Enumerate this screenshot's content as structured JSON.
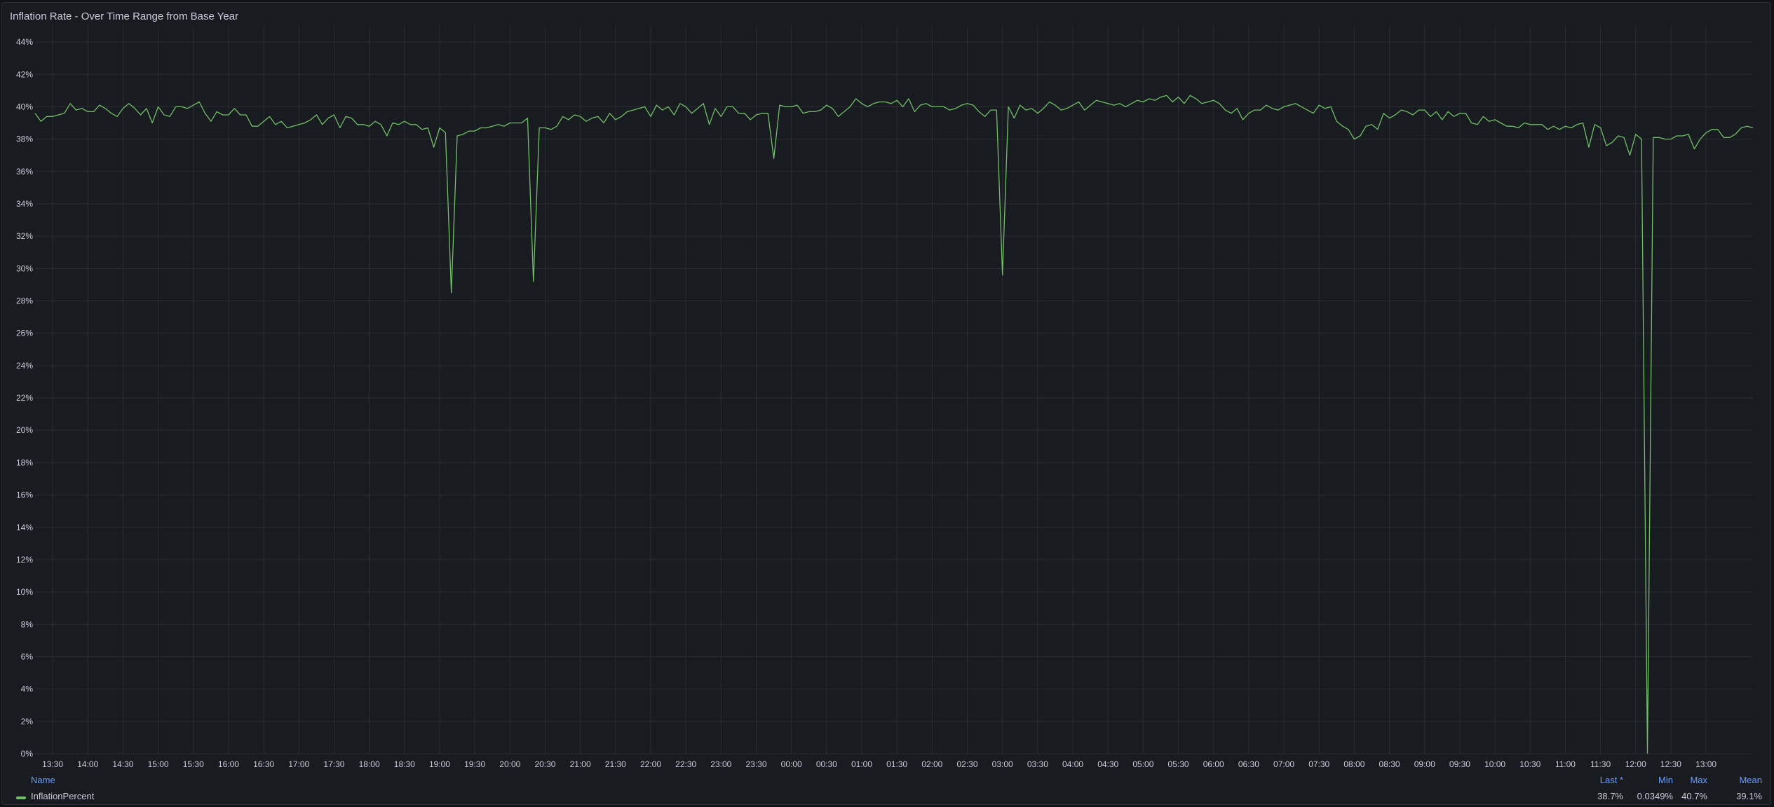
{
  "panel": {
    "title": "Inflation Rate - Over Time Range from Base Year"
  },
  "legend": {
    "headers": {
      "name": "Name",
      "last": "Last *",
      "min": "Min",
      "max": "Max",
      "mean": "Mean"
    },
    "series": [
      {
        "name": "InflationPercent",
        "color": "#73bf69",
        "last": "38.7%",
        "min": "0.0349%",
        "max": "40.7%",
        "mean": "39.1%"
      }
    ]
  },
  "chart_data": {
    "type": "line",
    "title": "Inflation Rate - Over Time Range from Base Year",
    "xlabel": "",
    "ylabel": "",
    "x_start": "13:15",
    "x_end": "13:00 (next day)",
    "x_step_minutes": 5,
    "x_ticks": [
      "13:30",
      "14:00",
      "14:30",
      "15:00",
      "15:30",
      "16:00",
      "16:30",
      "17:00",
      "17:30",
      "18:00",
      "18:30",
      "19:00",
      "19:30",
      "20:00",
      "20:30",
      "21:00",
      "21:30",
      "22:00",
      "22:30",
      "23:00",
      "23:30",
      "00:00",
      "00:30",
      "01:00",
      "01:30",
      "02:00",
      "02:30",
      "03:00",
      "03:30",
      "04:00",
      "04:30",
      "05:00",
      "05:30",
      "06:00",
      "06:30",
      "07:00",
      "07:30",
      "08:00",
      "08:30",
      "09:00",
      "09:30",
      "10:00",
      "10:30",
      "11:00",
      "11:30",
      "12:00",
      "12:30",
      "13:00"
    ],
    "y_ticks": [
      "0%",
      "2%",
      "4%",
      "6%",
      "8%",
      "10%",
      "12%",
      "14%",
      "16%",
      "18%",
      "20%",
      "22%",
      "24%",
      "26%",
      "28%",
      "30%",
      "32%",
      "34%",
      "36%",
      "38%",
      "40%",
      "42%",
      "44%"
    ],
    "ylim": [
      0,
      45
    ],
    "grid": true,
    "legend_placement": "bottom",
    "series": [
      {
        "name": "InflationPercent",
        "color": "#73bf69",
        "values": [
          39.6,
          39.1,
          39.4,
          39.4,
          39.5,
          39.6,
          40.2,
          39.8,
          39.9,
          39.7,
          39.7,
          40.1,
          39.9,
          39.6,
          39.4,
          39.9,
          40.2,
          39.9,
          39.5,
          39.9,
          39.0,
          40.0,
          39.5,
          39.4,
          40.0,
          40.0,
          39.9,
          40.1,
          40.3,
          39.6,
          39.1,
          39.7,
          39.5,
          39.5,
          39.9,
          39.5,
          39.5,
          38.8,
          38.8,
          39.1,
          39.4,
          38.9,
          39.1,
          38.7,
          38.8,
          38.9,
          39.0,
          39.2,
          39.5,
          38.9,
          39.3,
          39.5,
          38.7,
          39.4,
          39.3,
          38.9,
          38.9,
          38.8,
          39.1,
          38.9,
          38.2,
          39.0,
          38.9,
          39.1,
          38.9,
          38.9,
          38.6,
          38.7,
          37.5,
          38.7,
          38.4,
          28.5,
          38.2,
          38.3,
          38.5,
          38.5,
          38.7,
          38.7,
          38.8,
          38.9,
          38.8,
          39.0,
          39.0,
          39.0,
          39.3,
          29.2,
          38.7,
          38.7,
          38.6,
          38.8,
          39.4,
          39.2,
          39.5,
          39.4,
          39.1,
          39.3,
          39.4,
          39.0,
          39.6,
          39.2,
          39.4,
          39.7,
          39.8,
          39.9,
          40.0,
          39.4,
          40.1,
          39.8,
          40.0,
          39.5,
          40.2,
          40.0,
          39.6,
          39.9,
          40.2,
          38.9,
          39.9,
          39.4,
          40.0,
          40.0,
          39.6,
          39.6,
          39.2,
          39.5,
          39.6,
          39.6,
          36.8,
          40.1,
          40.0,
          40.0,
          40.1,
          39.6,
          39.7,
          39.7,
          39.8,
          40.1,
          39.9,
          39.4,
          39.7,
          40.0,
          40.5,
          40.2,
          40.0,
          40.2,
          40.3,
          40.3,
          40.2,
          40.4,
          40.0,
          40.5,
          39.7,
          40.1,
          40.2,
          40.0,
          40.0,
          40.0,
          39.8,
          39.9,
          40.1,
          40.2,
          40.1,
          39.7,
          39.4,
          39.8,
          39.8,
          29.6,
          40.0,
          39.3,
          40.1,
          39.8,
          39.9,
          39.6,
          39.9,
          40.3,
          40.1,
          39.8,
          39.9,
          40.1,
          40.3,
          39.8,
          40.1,
          40.4,
          40.3,
          40.2,
          40.1,
          40.2,
          40.0,
          40.2,
          40.4,
          40.3,
          40.5,
          40.4,
          40.6,
          40.7,
          40.3,
          40.6,
          40.2,
          40.7,
          40.5,
          40.2,
          40.3,
          40.4,
          40.2,
          39.8,
          39.6,
          39.9,
          39.2,
          39.6,
          39.8,
          39.8,
          40.1,
          39.9,
          39.8,
          40.0,
          40.1,
          40.2,
          40.0,
          39.8,
          39.6,
          40.1,
          39.9,
          40.0,
          39.1,
          38.8,
          38.6,
          38.0,
          38.2,
          38.8,
          38.9,
          38.6,
          39.6,
          39.3,
          39.5,
          39.8,
          39.7,
          39.5,
          39.8,
          39.8,
          39.4,
          39.7,
          39.2,
          39.7,
          39.4,
          39.6,
          39.6,
          39.0,
          38.9,
          39.4,
          39.1,
          39.2,
          39.0,
          38.8,
          38.8,
          38.7,
          39.0,
          38.9,
          38.9,
          38.9,
          38.6,
          38.8,
          38.6,
          38.8,
          38.7,
          38.9,
          39.0,
          37.5,
          38.9,
          38.7,
          37.6,
          37.8,
          38.2,
          38.1,
          37.0,
          38.3,
          38.0,
          0.0349,
          38.1,
          38.1,
          38.0,
          38.0,
          38.2,
          38.2,
          38.3,
          37.4,
          38.0,
          38.4,
          38.6,
          38.6,
          38.1,
          38.1,
          38.3,
          38.7,
          38.8,
          38.7
        ]
      }
    ]
  }
}
